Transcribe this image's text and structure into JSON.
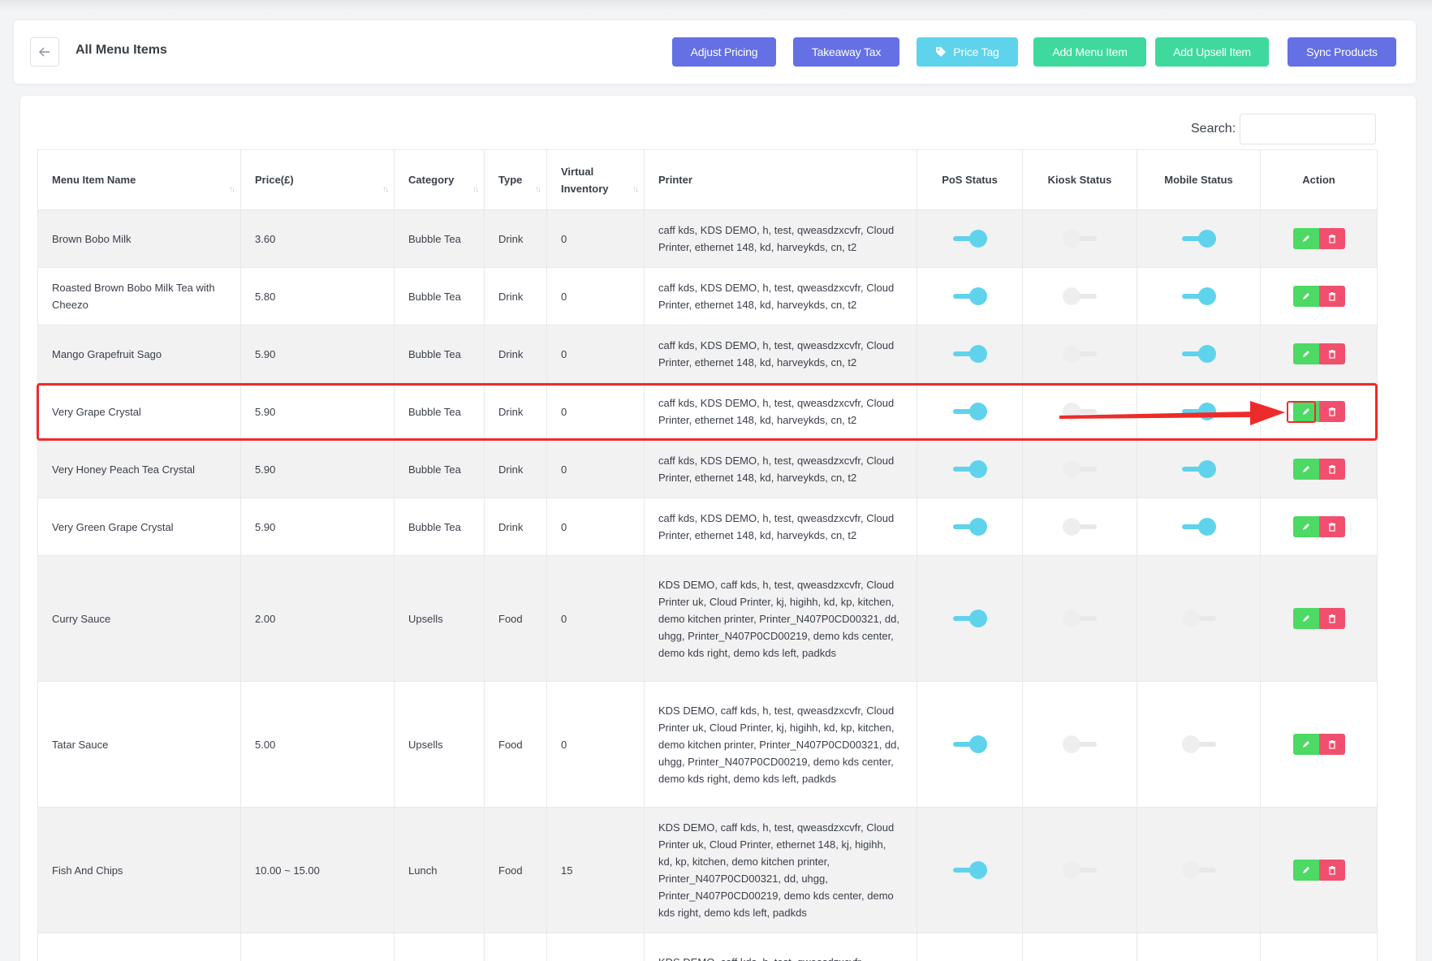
{
  "header": {
    "title": "All Menu Items",
    "buttons": {
      "adjust_pricing": "Adjust Pricing",
      "takeaway_tax": "Takeaway Tax",
      "price_tag": "Price Tag",
      "add_menu_item": "Add Menu Item",
      "add_upsell_item": "Add Upsell Item",
      "sync_products": "Sync Products"
    }
  },
  "search": {
    "label": "Search:",
    "value": "",
    "placeholder": ""
  },
  "table": {
    "columns": [
      "Menu Item Name",
      "Price(£)",
      "Category",
      "Type",
      "Virtual Inventory",
      "Printer",
      "PoS Status",
      "Kiosk Status",
      "Mobile Status",
      "Action"
    ],
    "rows": [
      {
        "name": "Brown Bobo Milk",
        "price": "3.60",
        "category": "Bubble Tea",
        "type": "Drink",
        "inventory": "0",
        "printer": "caff kds, KDS DEMO, h, test, qweasdzxcvfr, Cloud Printer, ethernet 148, kd, harveykds, cn, t2",
        "pos": true,
        "kiosk": false,
        "mobile": true
      },
      {
        "name": "Roasted Brown Bobo Milk Tea with Cheezo",
        "price": "5.80",
        "category": "Bubble Tea",
        "type": "Drink",
        "inventory": "0",
        "printer": "caff kds, KDS DEMO, h, test, qweasdzxcvfr, Cloud Printer, ethernet 148, kd, harveykds, cn, t2",
        "pos": true,
        "kiosk": false,
        "mobile": true
      },
      {
        "name": "Mango Grapefruit Sago",
        "price": "5.90",
        "category": "Bubble Tea",
        "type": "Drink",
        "inventory": "0",
        "printer": "caff kds, KDS DEMO, h, test, qweasdzxcvfr, Cloud Printer, ethernet 148, kd, harveykds, cn, t2",
        "pos": true,
        "kiosk": false,
        "mobile": true
      },
      {
        "name": "Very Grape Crystal",
        "price": "5.90",
        "category": "Bubble Tea",
        "type": "Drink",
        "inventory": "0",
        "printer": "caff kds, KDS DEMO, h, test, qweasdzxcvfr, Cloud Printer, ethernet 148, kd, harveykds, cn, t2",
        "pos": true,
        "kiosk": false,
        "mobile": true
      },
      {
        "name": "Very Honey Peach Tea Crystal",
        "price": "5.90",
        "category": "Bubble Tea",
        "type": "Drink",
        "inventory": "0",
        "printer": "caff kds, KDS DEMO, h, test, qweasdzxcvfr, Cloud Printer, ethernet 148, kd, harveykds, cn, t2",
        "pos": true,
        "kiosk": false,
        "mobile": true
      },
      {
        "name": "Very Green Grape Crystal",
        "price": "5.90",
        "category": "Bubble Tea",
        "type": "Drink",
        "inventory": "0",
        "printer": "caff kds, KDS DEMO, h, test, qweasdzxcvfr, Cloud Printer, ethernet 148, kd, harveykds, cn, t2",
        "pos": true,
        "kiosk": false,
        "mobile": true
      },
      {
        "name": "Curry Sauce",
        "price": "2.00",
        "category": "Upsells",
        "type": "Food",
        "inventory": "0",
        "printer": "KDS DEMO, caff kds, h, test, qweasdzxcvfr, Cloud Printer uk, Cloud Printer, kj, higihh, kd, kp, kitchen, demo kitchen printer, Printer_N407P0CD00321, dd, uhgg, Printer_N407P0CD00219, demo kds center, demo kds right, demo kds left, padkds",
        "pos": true,
        "kiosk": false,
        "mobile": false
      },
      {
        "name": "Tatar Sauce",
        "price": "5.00",
        "category": "Upsells",
        "type": "Food",
        "inventory": "0",
        "printer": "KDS DEMO, caff kds, h, test, qweasdzxcvfr, Cloud Printer uk, Cloud Printer, kj, higihh, kd, kp, kitchen, demo kitchen printer, Printer_N407P0CD00321, dd, uhgg, Printer_N407P0CD00219, demo kds center, demo kds right, demo kds left, padkds",
        "pos": true,
        "kiosk": false,
        "mobile": false
      },
      {
        "name": "Fish And Chips",
        "price": "10.00 ~ 15.00",
        "category": "Lunch",
        "type": "Food",
        "inventory": "15",
        "printer": "KDS DEMO, caff kds, h, test, qweasdzxcvfr, Cloud Printer uk, Cloud Printer, ethernet 148, kj, higihh, kd, kp, kitchen, demo kitchen printer, Printer_N407P0CD00321, dd, uhgg, Printer_N407P0CD00219, demo kds center, demo kds right, demo kds left, padkds",
        "pos": true,
        "kiosk": false,
        "mobile": false
      },
      {
        "name": "",
        "price": "",
        "category": "",
        "type": "",
        "inventory": "",
        "printer": "KDS DEMO, caff kds, h, test, qweasdzxcvfr,",
        "pos": null,
        "kiosk": null,
        "mobile": null
      }
    ]
  },
  "colors": {
    "primary_blue": "#6470e4",
    "cyan": "#5fd3ec",
    "green": "#3fd99d",
    "edit_green": "#4cd964",
    "delete_red": "#f0506e",
    "annotation_red": "#ee2b2b"
  },
  "icons": {
    "back": "arrow-left-icon",
    "price_tag": "tag-icon",
    "edit": "pencil-icon",
    "delete": "trash-icon",
    "sort": "sort-icon"
  }
}
